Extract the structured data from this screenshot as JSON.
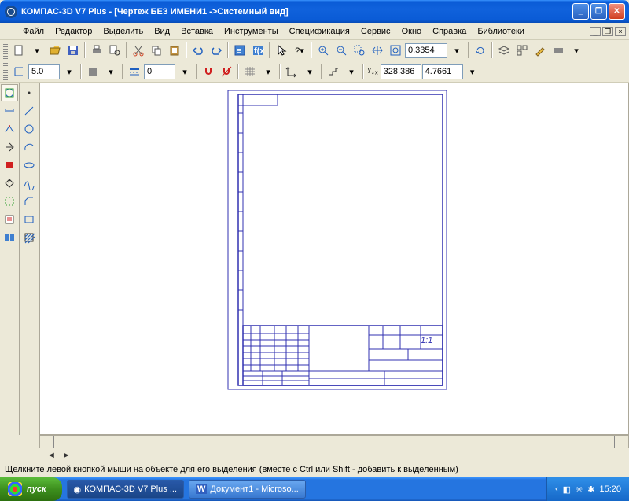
{
  "title": "КОМПАС-3D V7 Plus - [Чертеж БЕЗ ИМЕНИ1 ->Системный вид]",
  "menu": [
    "Файл",
    "Редактор",
    "Выделить",
    "Вид",
    "Вставка",
    "Инструменты",
    "Спецификация",
    "Сервис",
    "Окно",
    "Справка",
    "Библиотеки"
  ],
  "toolbar2": {
    "zoom": "0.3354"
  },
  "toolbar3": {
    "scale": "5.0",
    "style": "0",
    "x": "328.386",
    "y": "4.7661"
  },
  "status": "Щелкните левой кнопкой мыши на объекте для его выделения (вместе с Ctrl или Shift - добавить к выделенным)",
  "taskbar": {
    "start": "пуск",
    "btn1": "КОМПАС-3D V7 Plus ...",
    "btn2": "Документ1 - Microso...",
    "time": "15:20"
  }
}
